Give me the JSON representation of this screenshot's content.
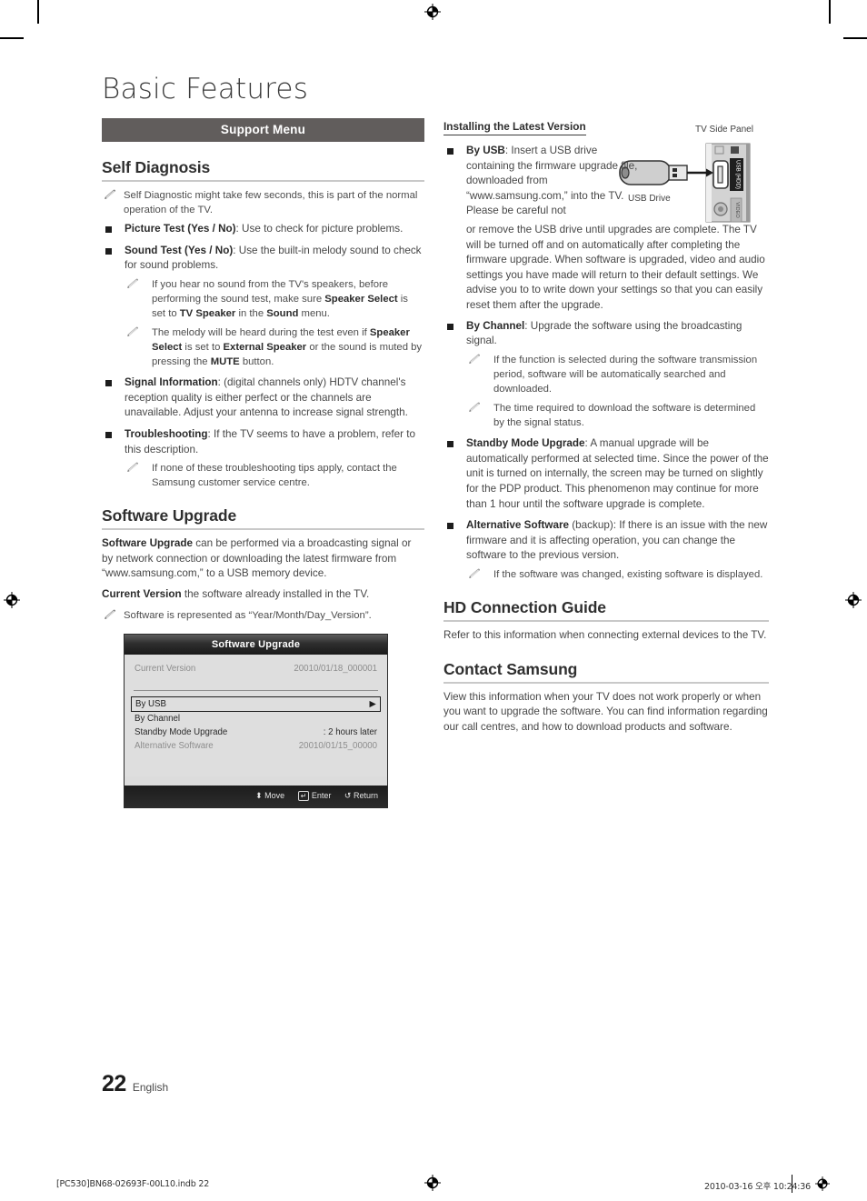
{
  "page": {
    "title": "Basic Features",
    "number": "22",
    "language": "English",
    "print_file": "[PC530]BN68-02693F-00L10.indb   22",
    "print_timestamp": "2010-03-16   오후 10:24:36"
  },
  "section_bar": {
    "label": "Support Menu"
  },
  "colors": {
    "bar_background": "#615d5c",
    "bar_text": "#ffffff",
    "rule": "#c9c9c9",
    "bullet": "#1d1d1d",
    "osd_title_dark": "#1a1a1a",
    "osd_body": "#dedede"
  },
  "left_column": {
    "self_diagnosis": {
      "heading": "Self Diagnosis",
      "notes_top": [
        "Self Diagnostic might take few seconds, this is part of the normal operation of the TV."
      ],
      "bullets": [
        {
          "term": "Picture Test (Yes / No)",
          "text": ": Use to check for picture problems.",
          "notes": []
        },
        {
          "term": "Sound Test (Yes / No)",
          "text": ": Use the built-in melody sound to check for sound problems.",
          "notes": [
            "If you hear no sound from the TV's speakers, before performing the sound test, make sure Speaker Select is set to TV Speaker in the Sound menu.",
            "The melody will be heard during the test even if Speaker Select is set to External Speaker or the sound is muted by pressing the MUTE button."
          ]
        },
        {
          "term": "Signal Information",
          "text": ": (digital channels only) HDTV channel's reception quality is either perfect or the channels are unavailable. Adjust your antenna to increase signal strength.",
          "notes": []
        },
        {
          "term": "Troubleshooting",
          "text": ": If the TV seems to have a problem, refer to this description.",
          "notes": [
            "If none of these troubleshooting tips apply, contact the Samsung customer service centre."
          ]
        }
      ]
    },
    "software_upgrade": {
      "heading": "Software Upgrade",
      "paragraph_1_bold": "Software Upgrade",
      "paragraph_1": " can be performed via a broadcasting signal or by network connection or downloading the latest firmware from “www.samsung.com,” to a USB memory device.",
      "paragraph_2_bold": "Current Version",
      "paragraph_2": " the software already installed in the TV.",
      "note": "Software is represented as “Year/Month/Day_Version”."
    },
    "osd": {
      "title": "Software Upgrade",
      "current_version_label": "Current Version",
      "current_version_value": "20010/01/18_000001",
      "items": [
        {
          "label": "By USB",
          "value": "▶",
          "selected": true
        },
        {
          "label": "By Channel",
          "value": "",
          "selected": false
        },
        {
          "label": "Standby Mode Upgrade",
          "value": ": 2 hours later",
          "selected": false
        },
        {
          "label": "Alternative Software",
          "value": "20010/01/15_00000",
          "selected": false,
          "dim": true
        }
      ],
      "footer_keys": [
        {
          "icon": "updown-arrow-icon",
          "label": "Move"
        },
        {
          "icon": "enter-key-icon",
          "label": "Enter"
        },
        {
          "icon": "return-arrow-icon",
          "label": "Return"
        }
      ]
    }
  },
  "right_column": {
    "installing": {
      "sub_heading": "Installing the Latest Version",
      "by_usb": {
        "term": "By USB",
        "text_wrapped": ": Insert a USB drive containing the firmware upgrade file, downloaded from “www.samsung.com,” into the TV. Please be careful not",
        "text_full": ": Insert a USB drive containing the firmware upgrade file, downloaded from “www.samsung.com,” into the TV. Please be careful not to disconnect the power or remove the USB drive until upgrades are complete. The TV will be turned off and on automatically after completing the firmware upgrade. When software is upgraded, video and audio settings you have made will return to their default settings. We advise you to to write down your settings so that you can easily reset them after the upgrade.",
        "text_rest": "or remove the USB drive until upgrades are complete. The TV will be turned off and on automatically after completing the firmware upgrade. When software is upgraded, video and audio settings you have made will return to their default settings. We advise you to to write down your settings so that you can easily reset them after the upgrade."
      },
      "figure": {
        "panel_label": "TV Side Panel",
        "drive_label": "USB Drive",
        "port_label": "USB (HDD)",
        "video_label": "VIDEO"
      },
      "bullets": [
        {
          "term": "By Channel",
          "text": ": Upgrade the software using the broadcasting signal.",
          "notes": [
            "If the function is selected during the software transmission period, software will be automatically searched and downloaded.",
            "The time required to download the software is determined by the signal status."
          ]
        },
        {
          "term": "Standby Mode Upgrade",
          "text": ": A manual upgrade will be automatically performed at selected time. Since the power of the unit is turned on internally, the screen may be turned on slightly for the PDP product. This phenomenon may continue for more than 1 hour until the software upgrade is complete.",
          "notes": []
        },
        {
          "term": "Alternative Software",
          "text": " (backup): If there is an issue with the new firmware and it is affecting operation, you can change the software to the previous version.",
          "notes": [
            "If the software was changed, existing software is displayed."
          ]
        }
      ]
    },
    "hd_connection_guide": {
      "heading": "HD Connection Guide",
      "body": "Refer to this information when connecting external devices to the TV."
    },
    "contact_samsung": {
      "heading": "Contact Samsung",
      "body": "View this information when your TV does not work properly or when you want to upgrade the software. You can find information regarding our call centres, and how to download products and software."
    }
  }
}
